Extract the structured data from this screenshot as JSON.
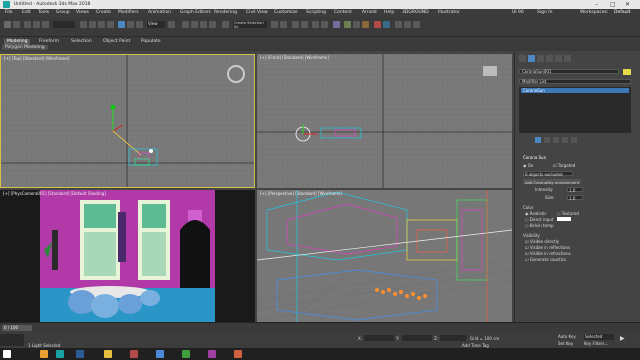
{
  "window": {
    "title": "Untitled - Autodesk 3ds Max 2018"
  },
  "menu": [
    "File",
    "Edit",
    "Tools",
    "Group",
    "Views",
    "Create",
    "Modifiers",
    "Animation",
    "Graph Editors",
    "Rendering",
    "Civil View",
    "Customize",
    "Scripting",
    "Content",
    "Arnold",
    "Help",
    "3DGROUND",
    "Illustrator"
  ],
  "toolbar": {
    "user_label": "UI 90",
    "sign_in": "Sign In",
    "workspace_label": "Workspaces:",
    "workspace_value": "Default",
    "selection_set": "Create Selection Se",
    "view_dropdown": "View",
    "grid_label": "Grid = 100 cm"
  },
  "ribbon": {
    "tabs": [
      "Modeling",
      "Freeform",
      "Selection",
      "Object Paint",
      "Populate"
    ],
    "active_tab": "Modeling",
    "subtitle": "Polygon Modeling"
  },
  "viewports": {
    "top": "[+] [Top] [Standard] [Wireframe]",
    "front": "[+] [Front] [Standard] [Wireframe]",
    "camera": "[+] [PhysCamera001] [Standard] [Default Shading]",
    "perspective": "[+] [Perspective] [Standard] [Wireframe]"
  },
  "command_panel": {
    "object_name": "CoronaSun001",
    "modifier_list": "Modifier List",
    "stack_item": "CoronaSun",
    "rollout_title": "Corona Sun",
    "on_label": "On",
    "targeted_label": "Targeted",
    "exclude_btn": "0 objects excluded",
    "add_env_btn": "Add CoronaSky environment",
    "intensity_label": "Intensity:",
    "intensity_value": "1.0",
    "size_label": "Size:",
    "size_value": "1.0",
    "color_title": "Color",
    "color_opts": [
      "Realistic",
      "Textured",
      "Direct input",
      "Kelvin temp"
    ],
    "visibility_title": "Visibility",
    "visibility_opts": [
      "Visible directly",
      "Visible in reflections",
      "Visible in refractions",
      "Generate caustics"
    ]
  },
  "timeline": {
    "frame": "0 / 100"
  },
  "status": {
    "message": "1 Light Selected",
    "x_label": "X:",
    "y_label": "Y:",
    "z_label": "Z:",
    "grid": "Grid = 100 cm",
    "add_time_tag": "Add Time Tag",
    "auto_key": "Auto Key",
    "set_key": "Set Key",
    "selected": "Selected",
    "key_filters": "Key Filters..."
  }
}
